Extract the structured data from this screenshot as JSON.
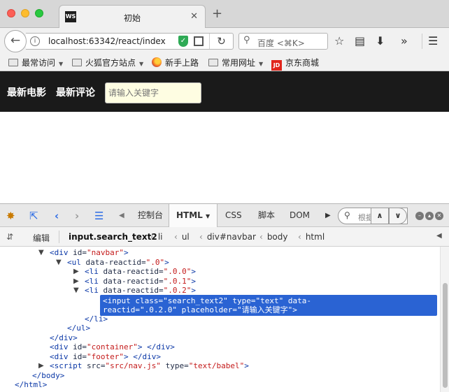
{
  "browser": {
    "tab_title": "初始",
    "tab_icon": "WS",
    "url": "localhost:63342/react/index",
    "search_placeholder": "百度 <⌘K>",
    "bookmarks": [
      {
        "label": "最常访问",
        "icon": "folder-icon",
        "has_menu": true
      },
      {
        "label": "火狐官方站点",
        "icon": "folder-icon",
        "has_menu": true
      },
      {
        "label": "新手上路",
        "icon": "firefox-icon",
        "has_menu": false
      },
      {
        "label": "常用网址",
        "icon": "folder-icon",
        "has_menu": true
      },
      {
        "label": "京东商城",
        "icon": "jd-icon",
        "has_menu": false
      }
    ],
    "jd_icon_text": "JD"
  },
  "page": {
    "nav_links": [
      "最新电影",
      "最新评论"
    ],
    "search_placeholder": "请输入关键字"
  },
  "devtools": {
    "tabs": [
      "控制台",
      "HTML",
      "CSS",
      "脚本",
      "DOM"
    ],
    "active_tab": "HTML",
    "search_placeholder": "根据",
    "edit_label": "编辑",
    "breadcrumbs": [
      "input.search_text2",
      "li",
      "ul",
      "div#navbar",
      "body",
      "html"
    ],
    "tree": [
      {
        "indent": 0,
        "tri": "open",
        "parts": [
          [
            "tag",
            "<div "
          ],
          [
            "attr",
            "id="
          ],
          [
            "val",
            "\"navbar\""
          ],
          [
            "tag",
            ">"
          ]
        ]
      },
      {
        "indent": 1,
        "tri": "open",
        "parts": [
          [
            "tag",
            "<ul "
          ],
          [
            "attr",
            "data-reactid="
          ],
          [
            "val",
            "\".0\""
          ],
          [
            "tag",
            ">"
          ]
        ]
      },
      {
        "indent": 2,
        "tri": "closed",
        "parts": [
          [
            "tag",
            "<li "
          ],
          [
            "attr",
            "data-reactid="
          ],
          [
            "val",
            "\".0.0\""
          ],
          [
            "tag",
            ">"
          ]
        ]
      },
      {
        "indent": 2,
        "tri": "closed",
        "parts": [
          [
            "tag",
            "<li "
          ],
          [
            "attr",
            "data-reactid="
          ],
          [
            "val",
            "\".0.1\""
          ],
          [
            "tag",
            ">"
          ]
        ]
      },
      {
        "indent": 2,
        "tri": "open",
        "parts": [
          [
            "tag",
            "<li "
          ],
          [
            "attr",
            "data-reactid="
          ],
          [
            "val",
            "\".0.2\""
          ],
          [
            "tag",
            ">"
          ]
        ]
      },
      {
        "selected": true,
        "lines": [
          "<input class=\"search_text2\" type=\"text\" data-",
          "reactid=\".0.2.0\" placeholder=\"请输入关键字\">"
        ]
      },
      {
        "indent": 2,
        "tri": "none",
        "parts": [
          [
            "tag",
            "</li>"
          ]
        ]
      },
      {
        "indent": 1,
        "tri": "none",
        "parts": [
          [
            "tag",
            "</ul>"
          ]
        ]
      },
      {
        "indent": 0,
        "tri": "none",
        "parts": [
          [
            "tag",
            "</div>"
          ]
        ]
      },
      {
        "indent": 0,
        "tri": "none",
        "parts": [
          [
            "tag",
            "<div "
          ],
          [
            "attr",
            "id="
          ],
          [
            "val",
            "\"container\""
          ],
          [
            "tag",
            "> </div>"
          ]
        ]
      },
      {
        "indent": 0,
        "tri": "none",
        "parts": [
          [
            "tag",
            "<div "
          ],
          [
            "attr",
            "id="
          ],
          [
            "val",
            "\"footer\""
          ],
          [
            "tag",
            "> </div>"
          ]
        ]
      },
      {
        "indent": 0,
        "tri": "closed",
        "parts": [
          [
            "tag",
            "<script "
          ],
          [
            "attr",
            "src="
          ],
          [
            "val",
            "\"src/nav.js\""
          ],
          [
            "attr",
            " type="
          ],
          [
            "val",
            "\"text/babel\""
          ],
          [
            "tag",
            ">"
          ]
        ]
      },
      {
        "indent": -1,
        "tri": "none",
        "parts": [
          [
            "tag",
            "</body>"
          ]
        ]
      },
      {
        "indent": -2,
        "tri": "none",
        "parts": [
          [
            "tag",
            "</html>"
          ]
        ]
      }
    ]
  },
  "colors": {
    "page_navbar_bg": "#1a1a1a",
    "search_bg": "#fefde2",
    "selection": "#2a63d3"
  }
}
